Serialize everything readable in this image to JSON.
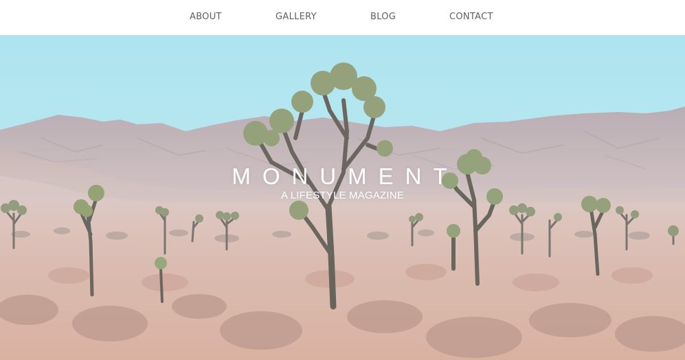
{
  "nav": {
    "items": [
      {
        "label": "ABOUT"
      },
      {
        "label": "GALLERY"
      },
      {
        "label": "BLOG"
      },
      {
        "label": "CONTACT"
      }
    ]
  },
  "hero": {
    "title": "MONUMENT",
    "subtitle": "A LIFESTYLE MAGAZINE",
    "image": "desert-joshua-tree-landscape"
  },
  "colors": {
    "nav_text": "#5f5f5f",
    "sky": "#aee2ec",
    "mountains": "#c9b5b4",
    "ground": "#d8b8ad",
    "hero_text": "#ffffff"
  }
}
